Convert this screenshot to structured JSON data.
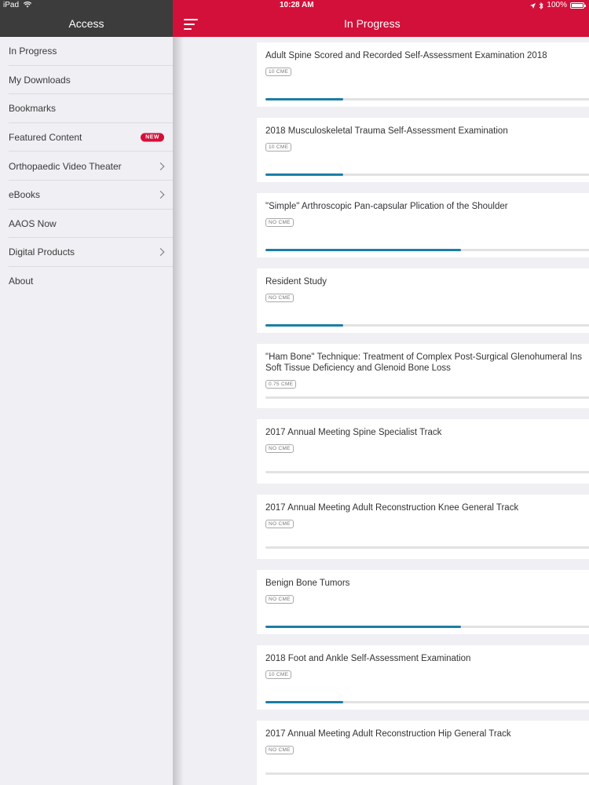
{
  "status": {
    "device": "iPad",
    "time": "10:28 AM",
    "battery": "100%"
  },
  "sidebar": {
    "title": "Access",
    "items": [
      {
        "label": "In Progress"
      },
      {
        "label": "My Downloads"
      },
      {
        "label": "Bookmarks"
      },
      {
        "label": "Featured Content",
        "badge": "NEW"
      },
      {
        "label": "Orthopaedic Video Theater",
        "chevron": true
      },
      {
        "label": "eBooks",
        "chevron": true
      },
      {
        "label": "AAOS Now"
      },
      {
        "label": "Digital Products",
        "chevron": true
      },
      {
        "label": "About"
      }
    ]
  },
  "main": {
    "title": "In Progress",
    "cards": [
      {
        "title": "Adult Spine Scored and Recorded Self-Assessment Examination 2018",
        "badge": "10 CME",
        "progress": 0.23
      },
      {
        "title": "2018 Musculoskeletal Trauma Self-Assessment Examination",
        "badge": "10 CME",
        "progress": 0.23
      },
      {
        "title": "\"Simple\" Arthroscopic Pan-capsular Plication of the Shoulder",
        "badge": "NO CME",
        "progress": 0.58
      },
      {
        "title": "Resident Study",
        "badge": "NO CME",
        "progress": 0.23
      },
      {
        "title": "\"Ham Bone\" Technique: Treatment of Complex Post-Surgical Glenohumeral Ins",
        "title2": "Soft Tissue Deficiency and Glenoid Bone Loss",
        "badge": "0.75 CME",
        "progress": 0
      },
      {
        "title": "2017 Annual Meeting Spine Specialist Track",
        "badge": "NO CME",
        "progress": 0
      },
      {
        "title": "2017 Annual Meeting Adult Reconstruction Knee General Track",
        "badge": "NO CME",
        "progress": 0
      },
      {
        "title": "Benign Bone Tumors",
        "badge": "NO CME",
        "progress": 0.58
      },
      {
        "title": "2018 Foot and Ankle Self-Assessment Examination",
        "badge": "10 CME",
        "progress": 0.23
      },
      {
        "title": "2017 Annual Meeting Adult Reconstruction Hip General Track",
        "badge": "NO CME",
        "progress": 0
      }
    ]
  },
  "colors": {
    "accent": "#d3103a",
    "progress": "#1b7ea4",
    "sidebar_header": "#3c3c3c"
  },
  "icons": [
    "wifi-icon",
    "menu-icon",
    "location-icon",
    "bluetooth-icon",
    "battery-icon",
    "chevron-right-icon"
  ]
}
